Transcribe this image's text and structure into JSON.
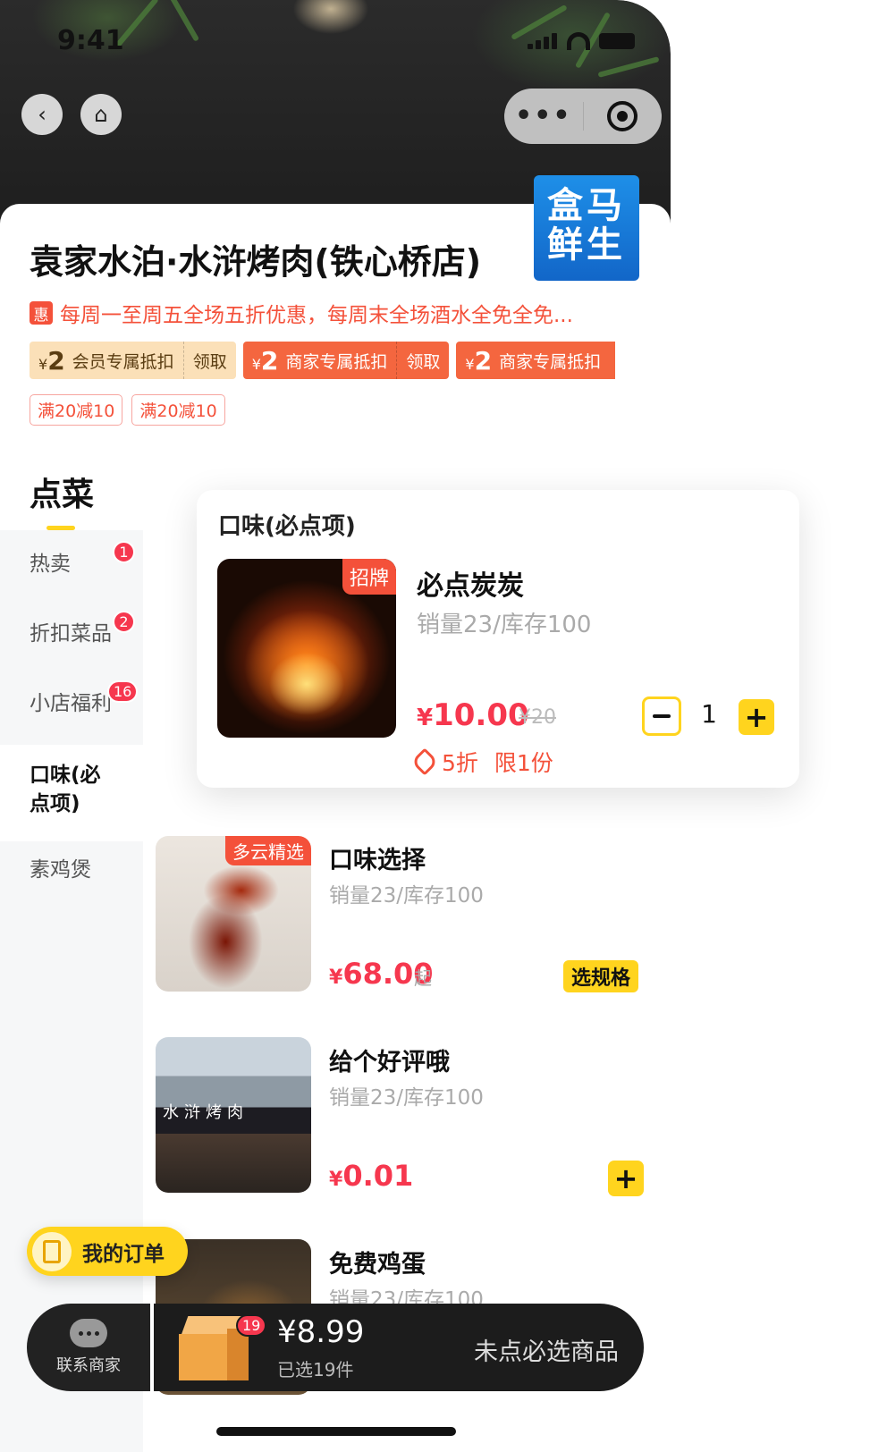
{
  "status": {
    "time": "9:41"
  },
  "shop": {
    "title": "袁家水泊·水浒烤肉(铁心桥店)",
    "logo_text_line1": "盒马",
    "logo_text_line2": "鲜生",
    "promo_badge": "惠",
    "promo_text": "每周一至周五全场五折优惠，每周末全场酒水全免全免..."
  },
  "coupons": [
    {
      "currency": "¥",
      "amount": "2",
      "label": "会员专属抵扣",
      "action": "领取",
      "style": "gold"
    },
    {
      "currency": "¥",
      "amount": "2",
      "label": "商家专属抵扣",
      "action": "领取",
      "style": "red"
    },
    {
      "currency": "¥",
      "amount": "2",
      "label": "商家专属抵扣",
      "action": "",
      "style": "red"
    }
  ],
  "tags": [
    "满20减10",
    "满20减10"
  ],
  "menu": {
    "header": "点菜",
    "items": [
      {
        "label": "热卖",
        "badge": "1"
      },
      {
        "label": "折扣菜品",
        "badge": "2"
      },
      {
        "label": "小店福利",
        "badge": "16"
      },
      {
        "label": "口味(必点项)",
        "badge": ""
      },
      {
        "label": "素鸡煲",
        "badge": ""
      }
    ]
  },
  "popup": {
    "section_title": "口味(必点项)",
    "product": {
      "ribbon": "招牌",
      "name": "必点炭炭",
      "sales": "销量23/库存100",
      "currency": "¥",
      "price": "10.00",
      "old_price": "¥20",
      "discount": "5折",
      "limit": "限1份",
      "quantity": "1"
    }
  },
  "products": [
    {
      "ribbon": "多云精选",
      "name": "口味选择",
      "sales": "销量23/库存100",
      "currency": "¥",
      "price": "68.00",
      "suffix": "起",
      "action": "选规格"
    },
    {
      "ribbon": "",
      "name": "给个好评哦",
      "sales": "销量23/库存100",
      "currency": "¥",
      "price": "0.01",
      "suffix": "",
      "action": "+",
      "sign_text": "水浒烤肉"
    },
    {
      "ribbon": "",
      "name": "免费鸡蛋",
      "sales": "销量23/库存100",
      "currency": "",
      "price": "",
      "suffix": "",
      "action": ""
    }
  ],
  "bottom": {
    "my_orders": "我的订单",
    "contact": "联系商家",
    "cart_badge": "19",
    "total": "¥8.99",
    "count": "已选19件",
    "required": "未点必选商品"
  },
  "colors": {
    "accent": "#ffd41e",
    "price": "#f6374e",
    "promo": "#f4513a",
    "dark_bar": "#1c1c1c"
  }
}
